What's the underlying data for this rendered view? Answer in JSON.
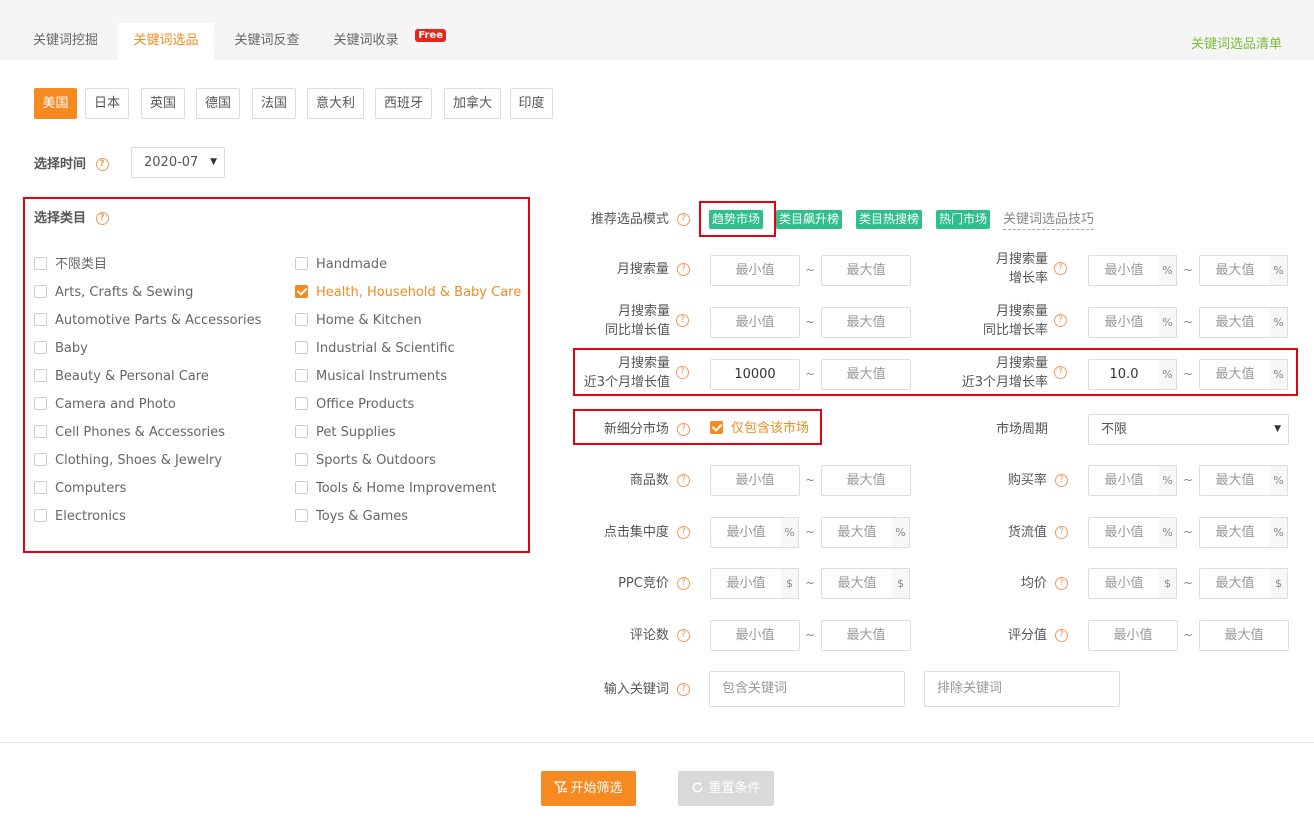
{
  "tabs": [
    {
      "label": "关键词挖掘"
    },
    {
      "label": "关键词选品"
    },
    {
      "label": "关键词反查"
    },
    {
      "label": "关键词收录"
    }
  ],
  "free_badge": "Free",
  "list_link": "关键词选品清单",
  "countries": [
    "美国",
    "日本",
    "英国",
    "德国",
    "法国",
    "意大利",
    "西班牙",
    "加拿大",
    "印度"
  ],
  "time": {
    "label": "选择时间",
    "value": "2020-07"
  },
  "help_glyph": "?",
  "caret_glyph": "▼",
  "category": {
    "label": "选择类目",
    "left": [
      "不限类目",
      "Arts, Crafts & Sewing",
      "Automotive Parts & Accessories",
      "Baby",
      "Beauty & Personal Care",
      "Camera and Photo",
      "Cell Phones & Accessories",
      "Clothing, Shoes & Jewelry",
      "Computers",
      "Electronics"
    ],
    "right": [
      "Handmade",
      "Health, Household & Baby Care",
      "Home & Kitchen",
      "Industrial & Scientific",
      "Musical Instruments",
      "Office Products",
      "Pet Supplies",
      "Sports & Outdoors",
      "Tools & Home Improvement",
      "Toys & Games"
    ],
    "checked": "Health, Household & Baby Care"
  },
  "mode": {
    "label": "推荐选品模式",
    "tags": [
      "趋势市场",
      "类目飙升榜",
      "类目热搜榜",
      "热门市场"
    ],
    "link": "关键词选品技巧"
  },
  "form": {
    "min": "最小值",
    "max": "最大值",
    "tilde": "~",
    "pct": "%",
    "dollar": "$",
    "monthly_search": "月搜索量",
    "monthly_growth": [
      "月搜索量",
      "增长率"
    ],
    "yoy_value": [
      "月搜索量",
      "同比增长值"
    ],
    "yoy_rate": [
      "月搜索量",
      "同比增长率"
    ],
    "q3_value": [
      "月搜索量",
      "近3个月增长值"
    ],
    "q3_value_input": "10000",
    "q3_rate": [
      "月搜索量",
      "近3个月增长率"
    ],
    "q3_rate_input": "10.0",
    "new_market": "新细分市场",
    "new_market_checkbox": "仅包含该市场",
    "market_cycle": "市场周期",
    "market_cycle_value": "不限",
    "product_count": "商品数",
    "purchase_rate": "购买率",
    "click_concentration": "点击集中度",
    "cargo_flow": "货流值",
    "ppc": "PPC竞价",
    "avg_price": "均价",
    "review_count": "评论数",
    "rating": "评分值",
    "keyword": "输入关键词",
    "include_placeholder": "包含关键词",
    "exclude_placeholder": "排除关键词"
  },
  "buttons": {
    "start": "开始筛选",
    "reset": "重置条件"
  }
}
